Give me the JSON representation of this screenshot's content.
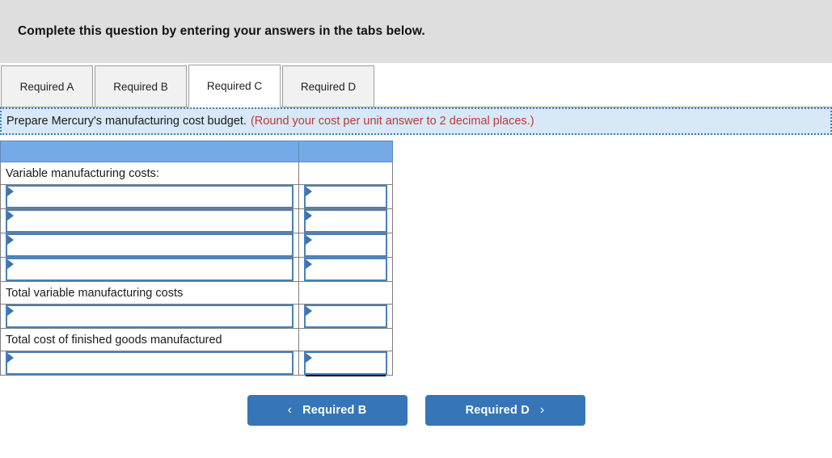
{
  "header": {
    "title": "Complete this question by entering your answers in the tabs below."
  },
  "tabs": [
    {
      "label": "Required A",
      "active": false
    },
    {
      "label": "Required B",
      "active": false
    },
    {
      "label": "Required C",
      "active": true
    },
    {
      "label": "Required D",
      "active": false
    }
  ],
  "requirement": {
    "prompt": "Prepare Mercury's manufacturing cost budget.",
    "hint": "(Round your cost per unit answer to 2 decimal places.)"
  },
  "table": {
    "columns": [
      "",
      ""
    ],
    "rows": [
      {
        "type": "header",
        "label": "",
        "value": ""
      },
      {
        "type": "text",
        "label": "Variable manufacturing costs:",
        "value": "",
        "value_type": "plain"
      },
      {
        "type": "select",
        "label": "",
        "value": "",
        "value_type": "select"
      },
      {
        "type": "select",
        "label": "",
        "value": "",
        "value_type": "select"
      },
      {
        "type": "select",
        "label": "",
        "value": "",
        "value_type": "select"
      },
      {
        "type": "select",
        "label": "",
        "value": "",
        "value_type": "select"
      },
      {
        "type": "text",
        "label": "Total variable manufacturing costs",
        "value": "",
        "value_type": "plain",
        "indent": true
      },
      {
        "type": "select",
        "label": "",
        "value": "",
        "value_type": "select"
      },
      {
        "type": "text",
        "label": "Total cost of finished goods manufactured",
        "value": "",
        "value_type": "plain",
        "rule": "single"
      },
      {
        "type": "select",
        "label": "",
        "value": "",
        "value_type": "select",
        "rule": "double"
      }
    ]
  },
  "navigation": {
    "prev_label": "Required B",
    "prev_icon": "chevron-left-icon",
    "prev_glyph": "‹",
    "next_label": "Required D",
    "next_icon": "chevron-right-icon",
    "next_glyph": "›"
  },
  "colors": {
    "banner_gray": "#DEDEDE",
    "table_header_blue": "#75AAE6",
    "button_blue": "#3575B8",
    "prompt_bg": "#D8E8F7",
    "prompt_border": "#3F7FC1",
    "hint_red": "#BB3A33",
    "select_border": "#4A7FBA"
  }
}
